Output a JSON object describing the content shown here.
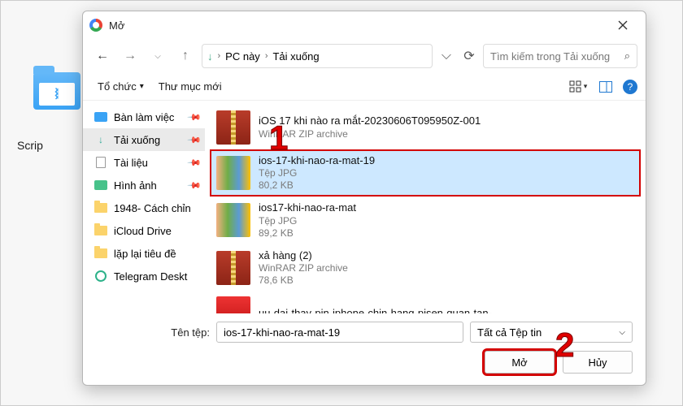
{
  "background": {
    "folder_label": "Scrip"
  },
  "dialog": {
    "title": "Mở",
    "nav": {
      "breadcrumb": {
        "root": "PC này",
        "current": "Tải xuống"
      },
      "search_placeholder": "Tìm kiếm trong Tải xuống"
    },
    "toolbar": {
      "organize": "Tổ chức",
      "new_folder": "Thư mục mới"
    },
    "sidebar": [
      {
        "icon": "desktop",
        "label": "Bàn làm việc",
        "pinned": true
      },
      {
        "icon": "downloads",
        "label": "Tải xuống",
        "pinned": true,
        "selected": true
      },
      {
        "icon": "documents",
        "label": "Tài liệu",
        "pinned": true
      },
      {
        "icon": "pictures",
        "label": "Hình ảnh",
        "pinned": true
      },
      {
        "icon": "folder",
        "label": "1948- Cách chỉn"
      },
      {
        "icon": "folder",
        "label": "iCloud Drive"
      },
      {
        "icon": "folder",
        "label": "lặp lại tiêu đề"
      },
      {
        "icon": "telegram",
        "label": "Telegram Deskt"
      }
    ],
    "files": [
      {
        "thumb": "zip",
        "name": "iOS 17 khi nào ra mắt-20230606T095950Z-001",
        "type": "WinRAR ZIP archive",
        "size": ""
      },
      {
        "thumb": "jpg",
        "name": "ios-17-khi-nao-ra-mat-19",
        "type": "Tệp JPG",
        "size": "80,2 KB",
        "selected": true
      },
      {
        "thumb": "jpg",
        "name": "ios17-khi-nao-ra-mat",
        "type": "Tệp JPG",
        "size": "89,2 KB"
      },
      {
        "thumb": "zip",
        "name": "xả hàng (2)",
        "type": "WinRAR ZIP archive",
        "size": "78,6 KB"
      },
      {
        "thumb": "banner",
        "name": "uu-dai-thay-pin-iphone-chin-hang-pisen-quan-tan-binh(banner)",
        "type": "",
        "size": ""
      }
    ],
    "footer": {
      "filename_label": "Tên tệp:",
      "filename_value": "ios-17-khi-nao-ra-mat-19",
      "filter_label": "Tất cả Tệp tin",
      "open_button": "Mở",
      "cancel_button": "Hủy"
    }
  }
}
